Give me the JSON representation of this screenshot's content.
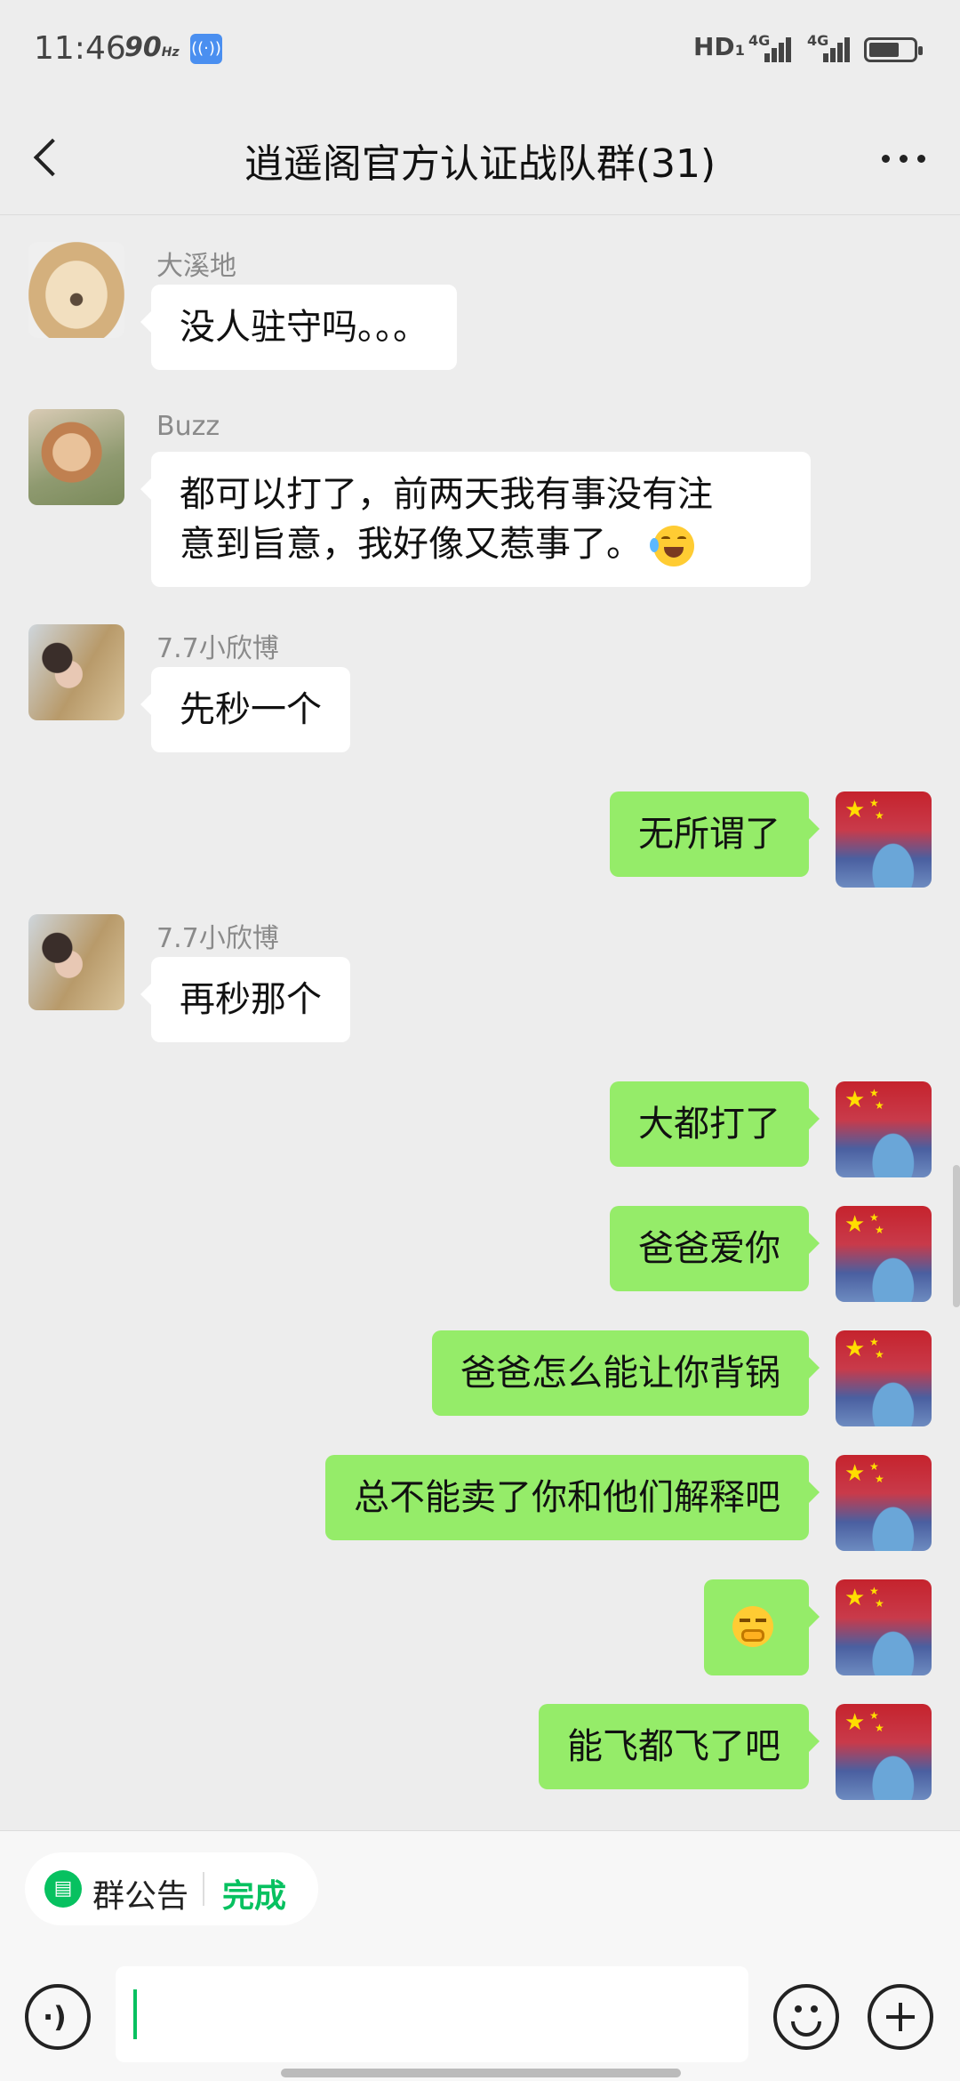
{
  "status_bar": {
    "time": "11:46",
    "refresh": "90",
    "refresh_unit": "Hz",
    "hd": "HD",
    "hd_sub": "1",
    "net1": "4G",
    "net2": "4G"
  },
  "header": {
    "title": "逍遥阁官方认证战队群(31)"
  },
  "messages": [
    {
      "side": "in",
      "avatar": "dog-avatar",
      "sender": "大溪地",
      "text": "没人驻守吗。。。"
    },
    {
      "side": "in",
      "avatar": "shiba-avatar",
      "sender": "Buzz",
      "text_line1": "都可以打了，前两天我有事没有注",
      "text_line2": "意到旨意，我好像又惹事了。",
      "emoji": "laughing-crying-emoji"
    },
    {
      "side": "in",
      "avatar": "baby-avatar",
      "sender": "7.7小欣博",
      "text": "先秒一个"
    },
    {
      "side": "out",
      "text": "无所谓了"
    },
    {
      "side": "in",
      "avatar": "baby-avatar",
      "sender": "7.7小欣博",
      "text": "再秒那个"
    },
    {
      "side": "out",
      "text": "大都打了"
    },
    {
      "side": "out",
      "text": "爸爸爱你"
    },
    {
      "side": "out",
      "text": "爸爸怎么能让你背锅"
    },
    {
      "side": "out",
      "text": "总不能卖了你和他们解释吧"
    },
    {
      "side": "out",
      "emoji": "smirk-emoji"
    },
    {
      "side": "out",
      "text": "能飞都飞了吧"
    }
  ],
  "bottom": {
    "notice_label": "群公告",
    "notice_done": "完成"
  },
  "colors": {
    "accent": "#07c160",
    "bubble_out": "#95ec69",
    "bubble_in": "#ffffff",
    "background": "#ededed"
  }
}
